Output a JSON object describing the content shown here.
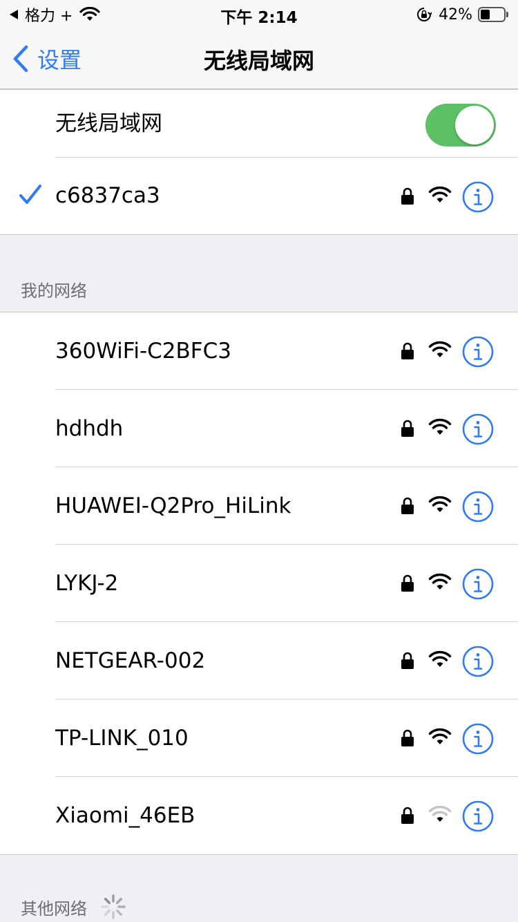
{
  "status_bar": {
    "carrier": "格力 +",
    "time": "下午 2:14",
    "battery_percent": "42%",
    "battery_level": 0.42
  },
  "nav": {
    "back_label": "设置",
    "title": "无线局域网"
  },
  "wifi_toggle": {
    "label": "无线局域网",
    "on": true
  },
  "connected_network": {
    "name": "c6837ca3",
    "secured": true,
    "signal": 3
  },
  "my_networks": {
    "header": "我的网络",
    "items": [
      {
        "name": "360WiFi-C2BFC3",
        "secured": true,
        "signal": 3
      },
      {
        "name": "hdhdh",
        "secured": true,
        "signal": 3
      },
      {
        "name": "HUAWEI-Q2Pro_HiLink",
        "secured": true,
        "signal": 3
      },
      {
        "name": "LYKJ-2",
        "secured": true,
        "signal": 3
      },
      {
        "name": "NETGEAR-002",
        "secured": true,
        "signal": 3
      },
      {
        "name": "TP-LINK_010",
        "secured": true,
        "signal": 3
      },
      {
        "name": "Xiaomi_46EB",
        "secured": true,
        "signal": 1
      }
    ]
  },
  "other_networks": {
    "header": "其他网络"
  },
  "colors": {
    "accent": "#2f7bf6",
    "toggle_on": "#5cc165",
    "section_text": "#6d6d72"
  }
}
